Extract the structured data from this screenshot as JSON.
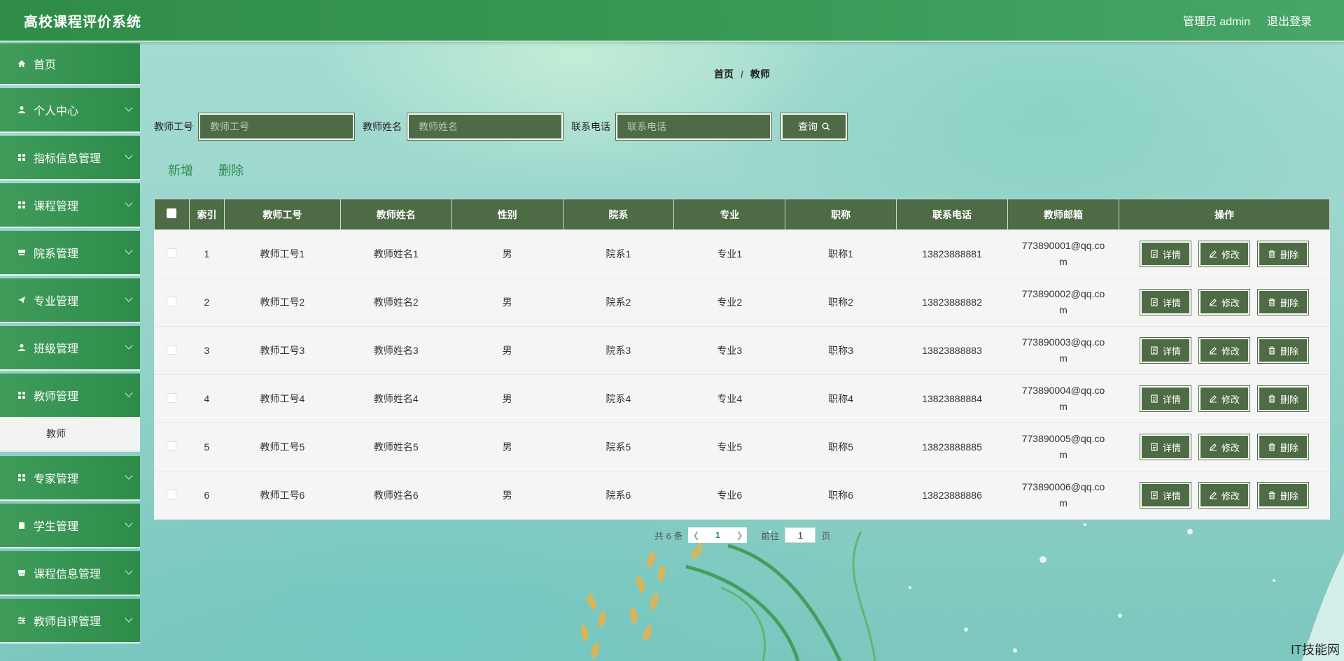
{
  "header": {
    "title": "高校课程评价系统",
    "user": "管理员 admin",
    "logout": "退出登录"
  },
  "sidebar": {
    "items": [
      {
        "label": "首页",
        "icon": "home-icon"
      },
      {
        "label": "个人中心",
        "icon": "user-icon"
      },
      {
        "label": "指标信息管理",
        "icon": "grid-icon"
      },
      {
        "label": "课程管理",
        "icon": "grid-icon"
      },
      {
        "label": "院系管理",
        "icon": "stack-icon"
      },
      {
        "label": "专业管理",
        "icon": "plane-icon"
      },
      {
        "label": "班级管理",
        "icon": "user-icon"
      },
      {
        "label": "教师管理",
        "icon": "grid-icon"
      },
      {
        "label": "专家管理",
        "icon": "grid-icon"
      },
      {
        "label": "学生管理",
        "icon": "clipboard-icon"
      },
      {
        "label": "课程信息管理",
        "icon": "stack-icon"
      },
      {
        "label": "教师自评管理",
        "icon": "sliders-icon"
      }
    ],
    "submenu_active": "教师"
  },
  "breadcrumb": {
    "home": "首页",
    "separator": "/",
    "current": "教师"
  },
  "search": {
    "fields": [
      {
        "label": "教师工号",
        "placeholder": "教师工号"
      },
      {
        "label": "教师姓名",
        "placeholder": "教师姓名"
      },
      {
        "label": "联系电话",
        "placeholder": "联系电话"
      }
    ],
    "query_label": "查询"
  },
  "actions": {
    "add": "新增",
    "delete": "删除"
  },
  "table": {
    "headers": [
      "索引",
      "教师工号",
      "教师姓名",
      "性别",
      "院系",
      "专业",
      "职称",
      "联系电话",
      "教师邮箱",
      "操作"
    ],
    "op_labels": {
      "detail": "详情",
      "edit": "修改",
      "delete": "删除"
    },
    "rows": [
      {
        "index": "1",
        "no": "教师工号1",
        "name": "教师姓名1",
        "gender": "男",
        "dept": "院系1",
        "major": "专业1",
        "title": "职称1",
        "phone": "13823888881",
        "email": "773890001@qq.com"
      },
      {
        "index": "2",
        "no": "教师工号2",
        "name": "教师姓名2",
        "gender": "男",
        "dept": "院系2",
        "major": "专业2",
        "title": "职称2",
        "phone": "13823888882",
        "email": "773890002@qq.com"
      },
      {
        "index": "3",
        "no": "教师工号3",
        "name": "教师姓名3",
        "gender": "男",
        "dept": "院系3",
        "major": "专业3",
        "title": "职称3",
        "phone": "13823888883",
        "email": "773890003@qq.com"
      },
      {
        "index": "4",
        "no": "教师工号4",
        "name": "教师姓名4",
        "gender": "男",
        "dept": "院系4",
        "major": "专业4",
        "title": "职称4",
        "phone": "13823888884",
        "email": "773890004@qq.com"
      },
      {
        "index": "5",
        "no": "教师工号5",
        "name": "教师姓名5",
        "gender": "男",
        "dept": "院系5",
        "major": "专业5",
        "title": "职称5",
        "phone": "13823888885",
        "email": "773890005@qq.com"
      },
      {
        "index": "6",
        "no": "教师工号6",
        "name": "教师姓名6",
        "gender": "男",
        "dept": "院系6",
        "major": "专业6",
        "title": "职称6",
        "phone": "13823888886",
        "email": "773890006@qq.com"
      }
    ]
  },
  "pagination": {
    "total": "共 6 条",
    "current_page": "1",
    "goto_label": "前往",
    "goto_value": "1",
    "page_suffix": "页"
  },
  "watermark": "IT技能网"
}
